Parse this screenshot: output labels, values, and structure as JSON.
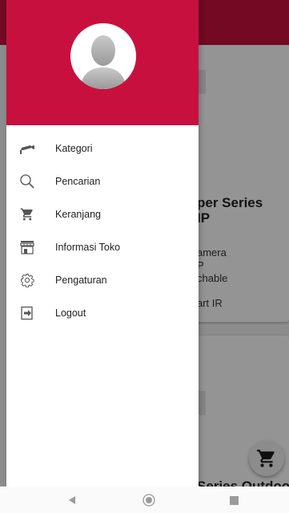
{
  "background": {
    "card1": {
      "title_line1": "per Series",
      "title_line2": "IP",
      "line1": "amera",
      "line2": "P",
      "line3": "chable",
      "line4": "art IR"
    },
    "card2": {
      "title": "Series Outdoor"
    }
  },
  "drawer": {
    "menu": [
      {
        "label": "Kategori",
        "icon": "cctv-camera-icon"
      },
      {
        "label": "Pencarian",
        "icon": "search-icon"
      },
      {
        "label": "Keranjang",
        "icon": "cart-icon"
      },
      {
        "label": "Informasi Toko",
        "icon": "store-icon"
      },
      {
        "label": "Pengaturan",
        "icon": "gear-icon"
      },
      {
        "label": "Logout",
        "icon": "logout-icon"
      }
    ]
  },
  "colors": {
    "primary": "#c8103f",
    "text": "#212121",
    "icon": "#555555"
  }
}
